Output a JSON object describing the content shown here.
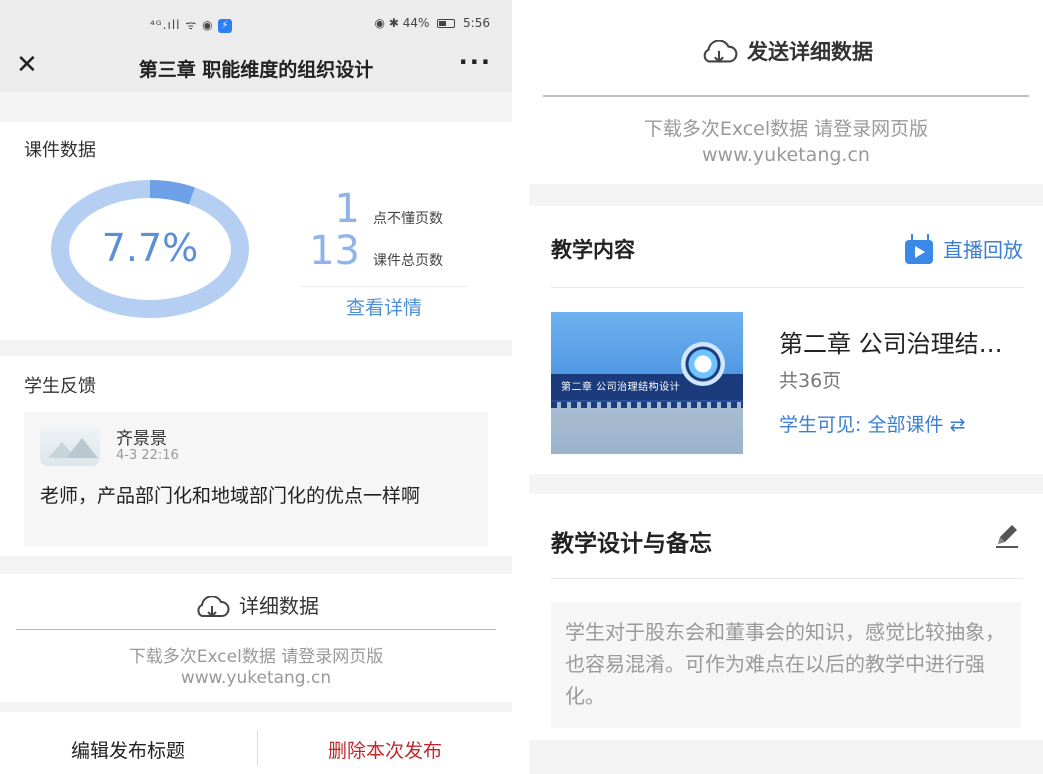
{
  "left": {
    "status": {
      "signal": "⁴ᴳ.ıll ᯤ ◉",
      "battery_pct": "44%",
      "time": "5:56"
    },
    "nav": {
      "title": "第三章 职能维度的组织设计"
    },
    "course": {
      "label": "课件数据",
      "percent_text": "7.7%",
      "percent_value": 7.7,
      "stat1_num": "1",
      "stat1_label": "点不懂页数",
      "stat2_num": "13",
      "stat2_label": "课件总页数",
      "detail_link": "查看详情"
    },
    "feedback": {
      "label": "学生反馈",
      "name": "齐景景",
      "time": "4-3 22:16",
      "text": "老师，产品部门化和地域部门化的优点一样啊"
    },
    "detail": {
      "title": "详细数据",
      "sub1": "下载多次Excel数据 请登录网页版",
      "sub2": "www.yuketang.cn"
    },
    "bottom": {
      "edit": "编辑发布标题",
      "delete": "删除本次发布"
    }
  },
  "right": {
    "detail": {
      "title": "发送详细数据",
      "sub1": "下载多次Excel数据 请登录网页版",
      "sub2": "www.yuketang.cn"
    },
    "teaching": {
      "title": "教学内容",
      "live": "直播回放",
      "ppt_title": "第二章 公司治理结…",
      "ppt_pages": "共36页",
      "visibility": "学生可见: 全部课件 ⇄",
      "thumb_text": "第二章 公司治理结构设计"
    },
    "design": {
      "title": "教学设计与备忘",
      "note": "学生对于股东会和董事会的知识，感觉比较抽象，也容易混淆。可作为难点在以后的教学中进行强化。"
    }
  },
  "colors": {
    "accent": "#3a7fd5",
    "delete": "#c0282d",
    "donut": "#b5cff3",
    "donut_highlight": "#5b8fd6"
  }
}
